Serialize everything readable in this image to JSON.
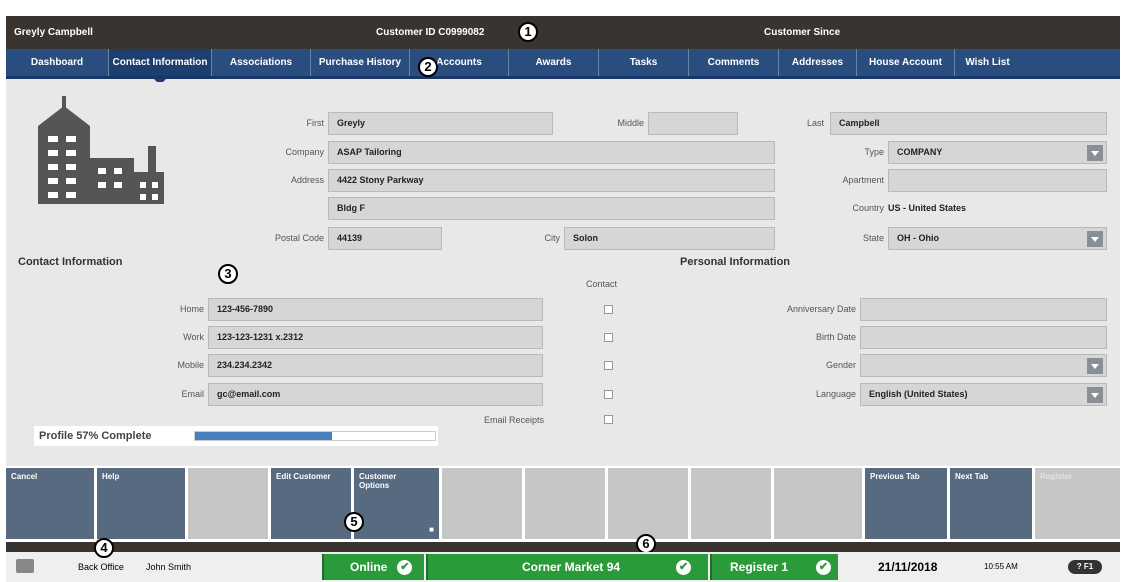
{
  "header": {
    "customer_name": "Greyly Campbell",
    "customer_id": "Customer ID  C0999082",
    "customer_since": "Customer Since"
  },
  "callouts": [
    "1",
    "2",
    "3",
    "4",
    "5",
    "6"
  ],
  "tabs": [
    "Dashboard",
    "Contact Information",
    "Associations",
    "Purchase History",
    "Accounts",
    "Awards",
    "Tasks",
    "Comments",
    "Addresses",
    "House Account",
    "Wish List"
  ],
  "form": {
    "first_label": "First",
    "first_value": "Greyly",
    "middle_label": "Middle",
    "middle_value": "",
    "last_label": "Last",
    "last_value": "Campbell",
    "company_label": "Company",
    "company_value": "ASAP Tailoring",
    "type_label": "Type",
    "type_value": "COMPANY",
    "address_label": "Address",
    "address_value": "4422 Stony Parkway",
    "address2_value": "Bldg F",
    "apartment_label": "Apartment",
    "apartment_value": "",
    "country_label": "Country",
    "country_value": "US - United States",
    "postal_label": "Postal Code",
    "postal_value": "44139",
    "city_label": "City",
    "city_value": "Solon",
    "state_label": "State",
    "state_value": "OH - Ohio"
  },
  "contact": {
    "title": "Contact Information",
    "contact_col": "Contact",
    "home_label": "Home",
    "home_value": "123-456-7890",
    "work_label": "Work",
    "work_value": "123-123-1231 x.2312",
    "mobile_label": "Mobile",
    "mobile_value": "234.234.2342",
    "email_label": "Email",
    "email_value": "gc@email.com",
    "email_receipts_label": "Email Receipts"
  },
  "personal": {
    "title": "Personal Information",
    "anniversary_label": "Anniversary Date",
    "anniversary_value": "",
    "birth_label": "Birth Date",
    "birth_value": "",
    "gender_label": "Gender",
    "gender_value": "",
    "language_label": "Language",
    "language_value": "English (United States)"
  },
  "profile": {
    "label": "Profile 57% Complete",
    "fraction": 0.57
  },
  "buttons": {
    "cancel": "Cancel",
    "help": "Help",
    "edit_customer": "Edit Customer",
    "customer_options": "Customer Options",
    "previous_tab": "Previous Tab",
    "next_tab": "Next Tab",
    "register": "Register"
  },
  "status": {
    "back_office": "Back Office",
    "user": "John Smith",
    "online": "Online",
    "store": "Corner Market 94",
    "register": "Register 1",
    "date": "21/11/2018",
    "time": "10:55 AM",
    "help_key": "? F1"
  },
  "colors": {
    "header": "#3a3431",
    "tabs": "#2a4d80",
    "button": "#586a80",
    "status_green": "#2a9a3a",
    "progress": "#4a7fbf"
  },
  "icons": [
    "building-icon",
    "dropdown-arrow-icon",
    "checkmark-icon",
    "register-icon",
    "key-icon"
  ]
}
